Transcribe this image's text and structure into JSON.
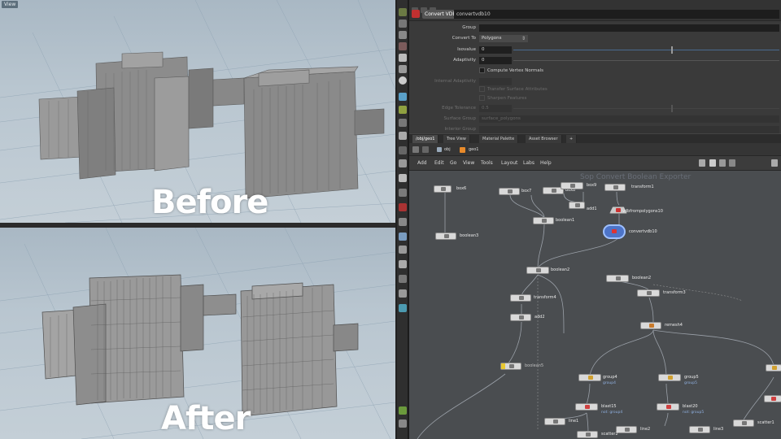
{
  "viewport_top": {
    "label": "View",
    "caption": "Before"
  },
  "viewport_bottom": {
    "caption": "After"
  },
  "params": {
    "node_type": "Convert VDB",
    "node_name": "convertvdb10",
    "group_label": "Group",
    "convert_to_label": "Convert To",
    "convert_to_value": "Polygons",
    "isovalue_label": "Isovalue",
    "isovalue_value": "0",
    "adaptivity_label": "Adaptivity",
    "adaptivity_value": "0",
    "compute_normals_label": "Compute Vertex Normals",
    "internal_adaptivity_label": "Internal Adaptivity",
    "transfer_label": "Transfer Surface Attributes",
    "sharpen_label": "Sharpen Features",
    "edge_tolerance_label": "Edge Tolerance",
    "edge_tolerance_value": "0.5",
    "surface_group_label": "Surface Group",
    "surface_group_value": "surface_polygons",
    "interior_group_label": "Interior Group"
  },
  "net_tabs": [
    "/obj/geo1",
    "Tree View",
    "Material Palette",
    "Asset Browser",
    "+"
  ],
  "net_path": {
    "obj": "obj",
    "geo": "geo1"
  },
  "net_menu": [
    "Add",
    "Edit",
    "Go",
    "View",
    "Tools",
    "Layout",
    "Labs",
    "Help"
  ],
  "net_watermark": "Sop Convert Boolean Exporter",
  "nodes": {
    "box6": "box6",
    "box7": "box7",
    "box8": "box8",
    "box9": "box9",
    "transform1": "transform1",
    "add1": "add1",
    "vdbfrompolygons10": "vdbfrompolygons10",
    "boolean1": "boolean1",
    "boolean3": "boolean3",
    "convertvdb10": "convertvdb10",
    "boolean2": "boolean2",
    "boolean_top": "boolean2",
    "transform4": "transform4",
    "add2": "add2",
    "transform3": "transform3",
    "remesh4": "remesh4",
    "boolean5": "boolean5",
    "group4": "group4",
    "group4_sub": "group4",
    "group5": "group5",
    "group5_sub": "group5",
    "blast15": "blast15",
    "blast15_sub": "not: group4",
    "blast20": "blast20",
    "blast20_sub": "not: group5",
    "line1": "line1",
    "line2": "line2",
    "line3": "line3",
    "scatter1": "scatter1",
    "scatter2": "scatter2"
  },
  "colors": {
    "accent": "#4a6a90",
    "node_selected": "#3f6fd0",
    "node_bypass": "#e8c830"
  }
}
